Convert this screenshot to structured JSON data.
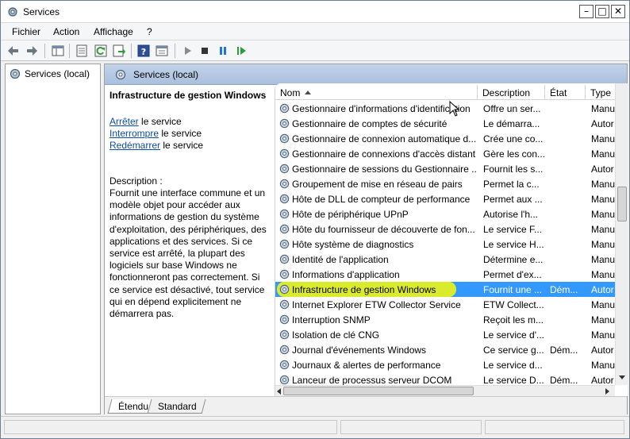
{
  "window": {
    "title": "Services",
    "controls": {
      "minimize": "–",
      "maximize": "□",
      "close": "✕"
    }
  },
  "menu": [
    "Fichier",
    "Action",
    "Affichage",
    "?"
  ],
  "toolbar": [
    "back-arrow-icon",
    "forward-arrow-icon",
    "show-hide-tree-icon",
    "properties-icon",
    "refresh-icon",
    "export-list-icon",
    "help-icon",
    "view-console-icon",
    "play-icon",
    "stop-icon",
    "pause-icon",
    "resume-icon"
  ],
  "tree": {
    "label": "Services (local)"
  },
  "pane": {
    "title": "Services (local)"
  },
  "details": {
    "service_name": "Infrastructure de gestion Windows",
    "actions": [
      {
        "link": "Arrêter",
        "suffix": " le service"
      },
      {
        "link": "Interrompre",
        "suffix": " le service"
      },
      {
        "link": "Redémarrer",
        "suffix": " le service"
      }
    ],
    "description_label": "Description :",
    "description": "Fournit une interface commune et un modèle objet pour accéder aux informations de gestion du système d'exploitation, des périphériques, des applications et des services. Si ce service est arrêté, la plupart des logiciels sur base Windows ne fonctionneront pas correctement. Si ce service est désactivé, tout service qui en dépend explicitement ne démarrera pas."
  },
  "table": {
    "columns": [
      "Nom",
      "Description",
      "État",
      "Type"
    ],
    "rows": [
      {
        "name": "Gestionnaire d'informations d'identification",
        "desc": "Offre un ser...",
        "etat": "",
        "type": "Manu"
      },
      {
        "name": "Gestionnaire de comptes de sécurité",
        "desc": "Le démarra...",
        "etat": "",
        "type": "Autor"
      },
      {
        "name": "Gestionnaire de connexion automatique d...",
        "desc": "Crée une co...",
        "etat": "",
        "type": "Manu"
      },
      {
        "name": "Gestionnaire de connexions d'accès distant",
        "desc": "Gère les con...",
        "etat": "",
        "type": "Manu"
      },
      {
        "name": "Gestionnaire de sessions du Gestionnaire ...",
        "desc": "Fournit les s...",
        "etat": "",
        "type": "Autor"
      },
      {
        "name": "Groupement de mise en réseau de pairs",
        "desc": "Permet la c...",
        "etat": "",
        "type": "Manu"
      },
      {
        "name": "Hôte de DLL de compteur de performance",
        "desc": "Permet aux ...",
        "etat": "",
        "type": "Manu"
      },
      {
        "name": "Hôte de périphérique UPnP",
        "desc": "Autorise l'h...",
        "etat": "",
        "type": "Manu"
      },
      {
        "name": "Hôte du fournisseur de découverte de fon...",
        "desc": "Le service F...",
        "etat": "",
        "type": "Manu"
      },
      {
        "name": "Hôte système de diagnostics",
        "desc": "Le service H...",
        "etat": "",
        "type": "Manu"
      },
      {
        "name": "Identité de l'application",
        "desc": "Détermine e...",
        "etat": "",
        "type": "Manu"
      },
      {
        "name": "Informations d'application",
        "desc": "Permet d'ex...",
        "etat": "",
        "type": "Manu"
      },
      {
        "name": "Infrastructure de gestion Windows",
        "desc": "Fournit une ...",
        "etat": "Dém...",
        "type": "Autor",
        "selected": true
      },
      {
        "name": "Internet Explorer ETW Collector Service",
        "desc": "ETW Collect...",
        "etat": "",
        "type": "Manu"
      },
      {
        "name": "Interruption SNMP",
        "desc": "Reçoit les m...",
        "etat": "",
        "type": "Manu"
      },
      {
        "name": "Isolation de clé CNG",
        "desc": "Le service d'...",
        "etat": "",
        "type": "Manu"
      },
      {
        "name": "Journal d'événements Windows",
        "desc": "Ce service g...",
        "etat": "Dém...",
        "type": "Autor"
      },
      {
        "name": "Journaux & alertes de performance",
        "desc": "Le service d...",
        "etat": "",
        "type": "Manu"
      },
      {
        "name": "Lanceur de processus serveur DCOM",
        "desc": "Le service D...",
        "etat": "Dém...",
        "type": "Autor"
      }
    ]
  },
  "tabs": [
    "Étendu",
    "Standard"
  ],
  "colors": {
    "selection": "#3399ff",
    "highlighter": "#e8f21a",
    "link": "#0c4da2",
    "header_gradient_top": "#c3d4ea",
    "header_gradient_bottom": "#a9bfdc"
  }
}
